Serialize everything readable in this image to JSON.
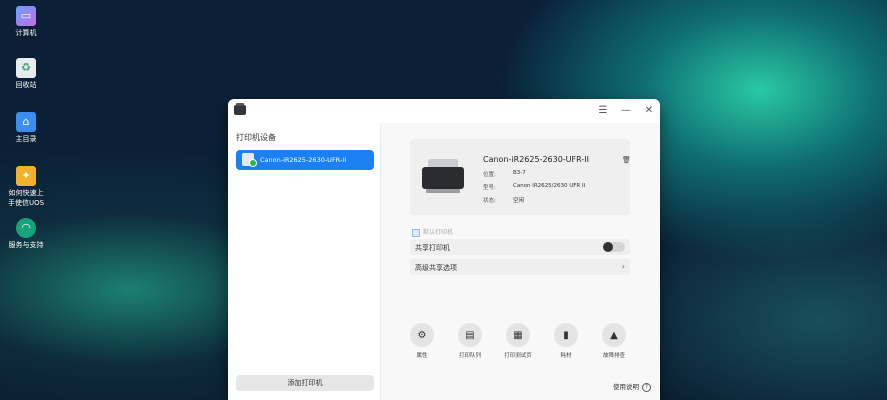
{
  "desktop": {
    "icons": [
      {
        "label": "计算机",
        "icon": "computer-icon"
      },
      {
        "label": "回收站",
        "icon": "trash-icon"
      },
      {
        "label": "主目录",
        "icon": "home-folder-icon"
      },
      {
        "label_line1": "如何快速上",
        "label_line2": "手使信UOS",
        "icon": "lightbulb-icon"
      },
      {
        "label": "服务与支持",
        "icon": "support-icon"
      }
    ]
  },
  "window": {
    "app_icon": "printer-app-icon",
    "menu_glyph": "☰",
    "minimize_glyph": "—",
    "close_glyph": "✕"
  },
  "left": {
    "title": "打印机设备",
    "printers": [
      {
        "name": "Canon-iR2625-2630-UFR-II",
        "selected": true
      }
    ],
    "add_button": "添加打印机"
  },
  "details": {
    "name": "Canon-iR2625-2630-UFR-II",
    "location_label": "位置:",
    "location_value": "B3-7",
    "model_label": "型号:",
    "model_value": "Canon iR2625/2630 UFR II",
    "status_label": "状态:",
    "status_value": "空闲",
    "delete_icon": "trash-icon",
    "default_label": "默认打印机",
    "default_checked": true,
    "share_label": "共享打印机",
    "share_enabled": false,
    "advanced_label": "高级共享选项"
  },
  "actions": [
    {
      "label": "属性",
      "icon": "gear-icon",
      "glyph": "⚙"
    },
    {
      "label": "打印队列",
      "icon": "queue-icon",
      "glyph": "▤"
    },
    {
      "label": "打印测试页",
      "icon": "test-page-icon",
      "glyph": "▦"
    },
    {
      "label": "耗材",
      "icon": "supplies-icon",
      "glyph": "▮"
    },
    {
      "label": "故障排查",
      "icon": "warning-icon",
      "glyph": "▲"
    }
  ],
  "help": {
    "label": "使用说明",
    "glyph": "?"
  },
  "colors": {
    "accent": "#1b81f2",
    "status_ok": "#2bb35a"
  }
}
